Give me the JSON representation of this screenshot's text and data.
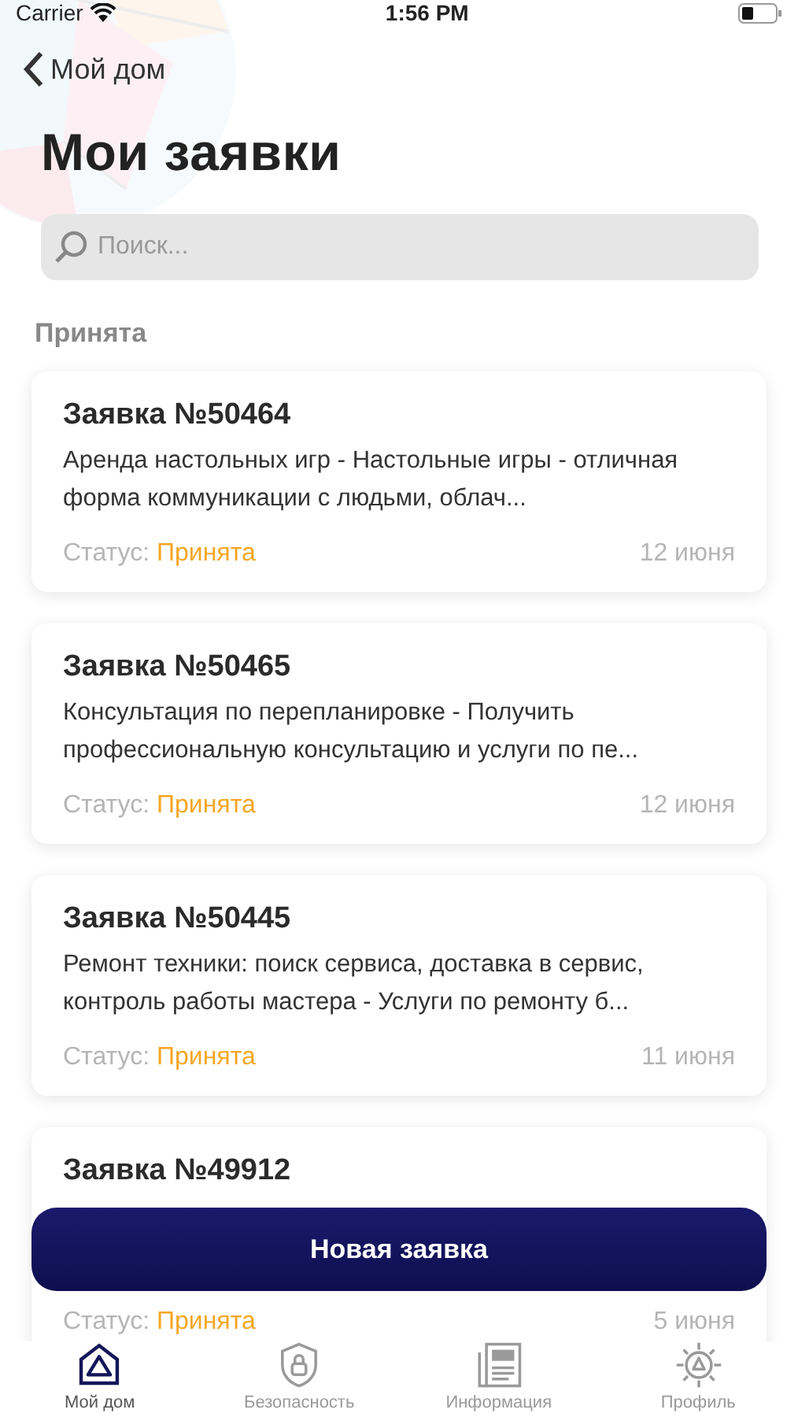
{
  "status_bar": {
    "carrier": "Carrier",
    "time": "1:56 PM"
  },
  "nav": {
    "back_label": "Мой дом",
    "title": "Мои заявки"
  },
  "search": {
    "placeholder": "Поиск..."
  },
  "section": "Принята",
  "requests": [
    {
      "title": "Заявка №50464",
      "description": "Аренда настольных игр  - Настольные игры  - отличная форма коммуникации с людьми, облач...",
      "status_label": "Статус:",
      "status": "Принята",
      "date": "12 июня"
    },
    {
      "title": "Заявка №50465",
      "description": "Консультация по перепланировке  - Получить профессиональную консультацию и услуги по пе...",
      "status_label": "Статус:",
      "status": "Принята",
      "date": "12 июня"
    },
    {
      "title": "Заявка №50445",
      "description": "Ремонт техники: поиск сервиса, доставка в сервис, контроль работы мастера  - Услуги по ремонту б...",
      "status_label": "Статус:",
      "status": "Принята",
      "date": "11 июня"
    },
    {
      "title": "Заявка №49912",
      "status_label": "Статус:",
      "status": "Принята",
      "date": "5 июня"
    }
  ],
  "new_button": "Новая заявка",
  "tabs": [
    {
      "kind": "home",
      "label": "Мой дом",
      "selected": true
    },
    {
      "kind": "security",
      "label": "Безопасность",
      "selected": false
    },
    {
      "kind": "info",
      "label": "Информация",
      "selected": false
    },
    {
      "kind": "profile",
      "label": "Профиль",
      "selected": false
    }
  ]
}
